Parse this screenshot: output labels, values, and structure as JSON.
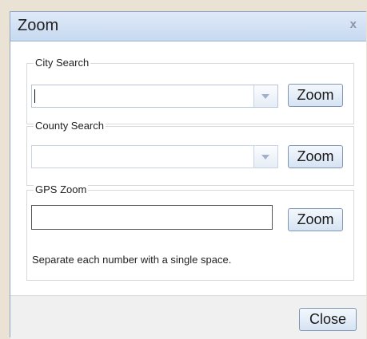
{
  "dialog": {
    "title": "Zoom",
    "close_symbol": "x"
  },
  "city": {
    "legend": "City Search",
    "input_value": "",
    "zoom_label": "Zoom"
  },
  "county": {
    "legend": "County Search",
    "input_value": "",
    "zoom_label": "Zoom"
  },
  "gps": {
    "legend": "GPS Zoom",
    "input_value": "",
    "zoom_label": "Zoom",
    "hint": "Separate each number with a single space."
  },
  "footer": {
    "close_label": "Close"
  },
  "icons": {
    "dropdown": "chevron-down-icon",
    "close": "close-icon"
  },
  "colors": {
    "titlebar": "#c7d9f0",
    "button": "#d6e3f3",
    "border": "#7f97b5"
  }
}
